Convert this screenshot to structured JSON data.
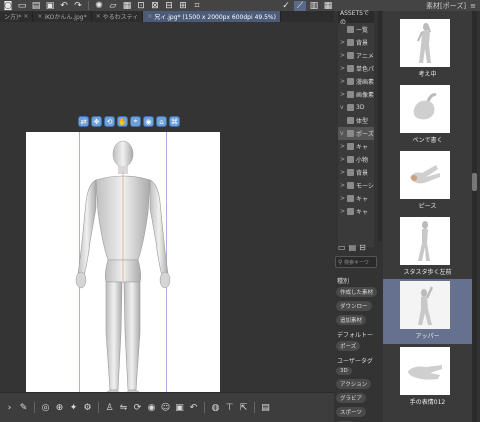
{
  "tabs": [
    {
      "label": "iKOかんん.jpg*",
      "active": false
    },
    {
      "label": "やるわスティ",
      "active": false
    },
    {
      "label": "兄ィ.jpg* (1500 x 2000px 600dpi 49.5%)",
      "active": true
    }
  ],
  "tab_first": "ン方)*",
  "float_toolbar": [
    "⇄",
    "✥",
    "⟲",
    "✋",
    "⌖",
    "◉",
    "⌂",
    "⌘"
  ],
  "sidebar_title": "素材[ポーズ]",
  "tree": {
    "header": "ASSETSでの",
    "items": [
      {
        "label": "ー覧",
        "chev": ""
      },
      {
        "label": "背景",
        "chev": ">"
      },
      {
        "label": "アニメ",
        "chev": ">"
      },
      {
        "label": "単色パ",
        "chev": ">"
      },
      {
        "label": "漫画素",
        "chev": ">"
      },
      {
        "label": "画像素",
        "chev": ">"
      },
      {
        "label": "3D",
        "chev": "v"
      },
      {
        "label": "体型",
        "chev": ""
      },
      {
        "label": "ポーズ",
        "chev": "v"
      },
      {
        "label": "キャ",
        "chev": ">"
      },
      {
        "label": "小物",
        "chev": ">"
      },
      {
        "label": "背景",
        "chev": ">"
      },
      {
        "label": "モーシ",
        "chev": ">"
      },
      {
        "label": "キャ",
        "chev": ">"
      },
      {
        "label": "キャ",
        "chev": ">"
      }
    ]
  },
  "search_placeholder": "検索キーワ",
  "tags_panel": {
    "section1": "種別",
    "tags1": [
      "作成した素材",
      "ダウンロー",
      "追加素材"
    ],
    "section2": "デフォルトー",
    "tags2": [
      "ポーズ"
    ],
    "section3": "ユーザータグ",
    "tags3": [
      "3D",
      "アクション",
      "グラビア",
      "スポーツ",
      "全身"
    ]
  },
  "thumbnails": [
    {
      "label": "考え中",
      "selected": false,
      "kind": "figure"
    },
    {
      "label": "ペンで書く",
      "selected": false,
      "kind": "hand"
    },
    {
      "label": "ピース",
      "selected": false,
      "kind": "hand"
    },
    {
      "label": "スタスタ歩く左前",
      "selected": false,
      "kind": "figure"
    },
    {
      "label": "アッパー",
      "selected": true,
      "kind": "figure"
    },
    {
      "label": "手の表情012",
      "selected": false,
      "kind": "hand"
    }
  ],
  "colors": {
    "accent": "#5a6a88",
    "selection": "#66708f",
    "guide": "#a7b0e8"
  }
}
